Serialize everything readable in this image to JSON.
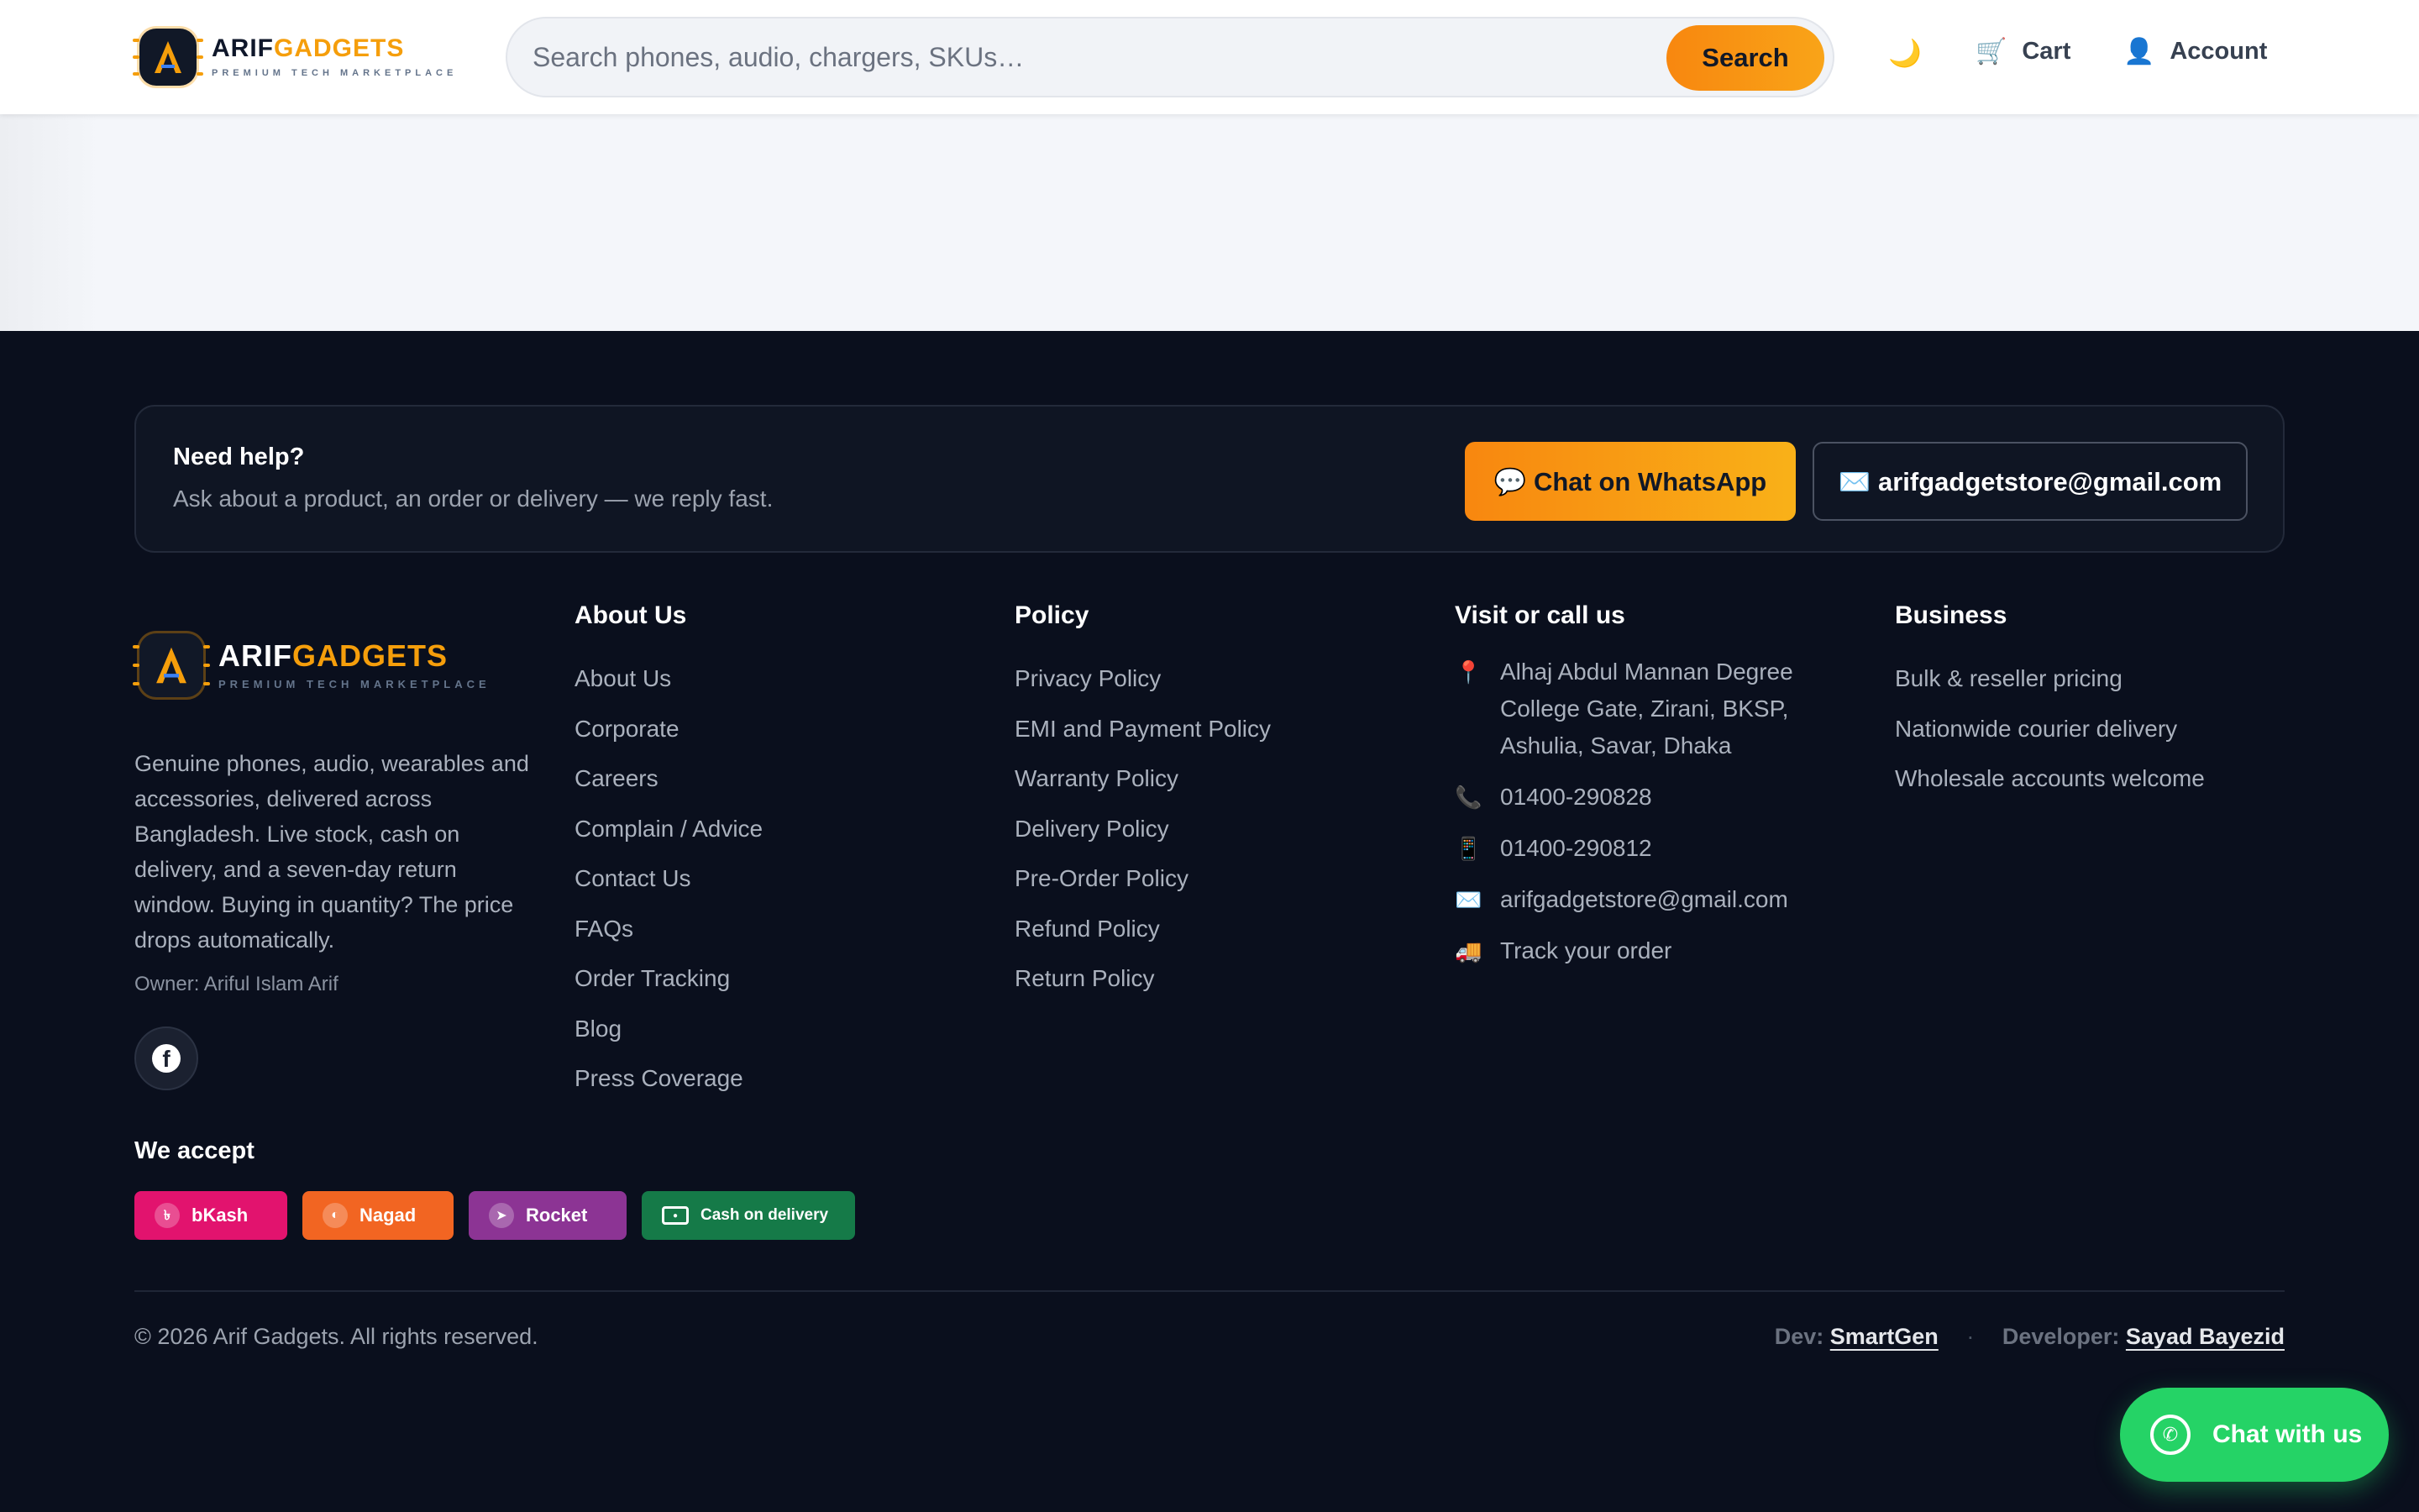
{
  "brand": {
    "name_part1": "ARIF",
    "name_part2": "GADGETS",
    "tagline": "PREMIUM TECH MARKETPLACE",
    "logo_letter": "A"
  },
  "header": {
    "search_placeholder": "Search phones, audio, chargers, SKUs…",
    "search_value": "",
    "search_button": "Search",
    "theme_icon": "moon-icon",
    "cart_label": "Cart",
    "account_label": "Account"
  },
  "help": {
    "title": "Need help?",
    "subtitle": "Ask about a product, an order or delivery — we reply fast.",
    "whatsapp_button": "💬 Chat on WhatsApp",
    "email_button": "✉️ arifgadgetstore@gmail.com"
  },
  "about_brand": {
    "description": "Genuine phones, audio, wearables and accessories, delivered across Bangladesh. Live stock, cash on delivery, and a seven-day return window. Buying in quantity? The price drops automatically.",
    "owner": "Owner: Ariful Islam Arif",
    "social": "facebook-icon"
  },
  "columns": {
    "about": {
      "title": "About Us",
      "items": [
        "About Us",
        "Corporate",
        "Careers",
        "Complain / Advice",
        "Contact Us",
        "FAQs",
        "Order Tracking",
        "Blog",
        "Press Coverage"
      ]
    },
    "policy": {
      "title": "Policy",
      "items": [
        "Privacy Policy",
        "EMI and Payment Policy",
        "Warranty Policy",
        "Delivery Policy",
        "Pre-Order Policy",
        "Refund Policy",
        "Return Policy"
      ]
    },
    "visit": {
      "title": "Visit or call us",
      "address": "Alhaj Abdul Mannan Degree College Gate, Zirani, BKSP, Ashulia, Savar, Dhaka",
      "phone": "01400-290828",
      "mobile": "01400-290812",
      "email": "arifgadgetstore@gmail.com",
      "track": "Track your order"
    },
    "business": {
      "title": "Business",
      "items": [
        "Bulk & reseller pricing",
        "Nationwide courier delivery",
        "Wholesale accounts welcome"
      ]
    }
  },
  "payments": {
    "title": "We accept",
    "methods": [
      {
        "label": "bKash",
        "color": "#e2136e"
      },
      {
        "label": "Nagad",
        "color": "#f26522"
      },
      {
        "label": "Rocket",
        "color": "#8c3494"
      },
      {
        "label": "Cash on delivery",
        "color": "#157a48"
      }
    ]
  },
  "bottom": {
    "copyright": "© 2026 Arif Gadgets. All rights reserved.",
    "dev_label": "Dev:",
    "dev_name": "SmartGen",
    "developer_label": "Developer:",
    "developer_name": "Sayad Bayezid"
  },
  "chat_widget": {
    "label": "Chat with us"
  },
  "colors": {
    "accent": "#f59e0b",
    "footer_bg": "#0a0f1d",
    "whatsapp": "#25d366"
  }
}
